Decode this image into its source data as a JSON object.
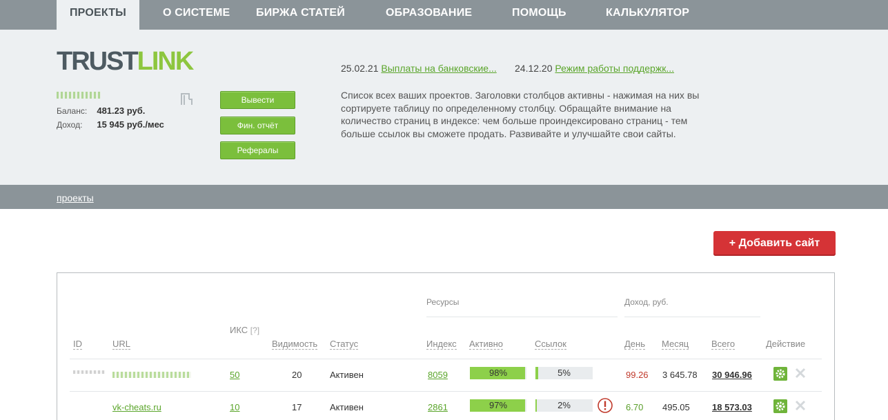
{
  "nav": {
    "tabs": [
      "ПРОЕКТЫ",
      "О СИСТЕМЕ",
      "БИРЖА СТАТЕЙ",
      "ОБРАЗОВАНИЕ",
      "ПОМОЩЬ",
      "КАЛЬКУЛЯТОР"
    ],
    "active_index": 0
  },
  "logo": {
    "part1": "TRUST",
    "part2": "LINK"
  },
  "account": {
    "balance_label": "Баланс:",
    "balance_value": "481.23  руб.",
    "income_label": "Доход:",
    "income_value": "15 945 руб./мес"
  },
  "buttons": {
    "withdraw": "Вывести",
    "fin_report": "Фин. отчёт",
    "referrals": "Рефералы",
    "add_site": "+ Добавить сайт"
  },
  "news": [
    {
      "date": "25.02.21",
      "title": "Выплаты на банковские..."
    },
    {
      "date": "24.12.20",
      "title": "Режим работы поддержк..."
    }
  ],
  "info_text": "Список всех ваших проектов. Заголовки столбцов активны - нажимая на них вы сортируете таблицу по определенному столбцу. Обращайте внимание на количество страниц в индексе: чем больше проиндексировано страниц - тем больше ссылок вы сможете продать. Развивайте и улучшайте свои сайты.",
  "breadcrumb": "проекты",
  "table": {
    "group_resources": "Ресурсы",
    "group_income": "Доход,  руб.",
    "iks_label": "ИКС",
    "iks_help": "[?]",
    "columns": {
      "id": "ID",
      "url": "URL",
      "visibility": "Видимость",
      "status": "Статус",
      "index": "Индекс",
      "active": "Активно",
      "links": "Ссылок",
      "day": "День",
      "month": "Месяц",
      "total": "Всего",
      "action": "Действие"
    },
    "rows": [
      {
        "id": "",
        "url": "",
        "iks": "50",
        "visibility": "20",
        "status": "Активен",
        "index": "8059",
        "active_pct": "98%",
        "active_value": 98,
        "links_pct": "5%",
        "links_value": 5,
        "warning": false,
        "day": "99.26",
        "day_color": "#c0392b",
        "month": "3 645.78",
        "total": "30 946.96"
      },
      {
        "id": "",
        "url": "vk-cheats.ru",
        "iks": "10",
        "visibility": "17",
        "status": "Активен",
        "index": "2861",
        "active_pct": "97%",
        "active_value": 97,
        "links_pct": "2%",
        "links_value": 2,
        "warning": true,
        "day": "6.70",
        "day_color": "#5a9e2a",
        "month": "495.05",
        "total": "18 573.03"
      }
    ]
  },
  "colors": {
    "nav_bg": "#8b9499",
    "header_bg": "#edf0f2",
    "accent_green": "#7bbf3c",
    "logo_green": "#8dc63f",
    "logo_dark": "#4d5a61",
    "add_button": "#d53336",
    "warning_red": "#c0392b"
  }
}
